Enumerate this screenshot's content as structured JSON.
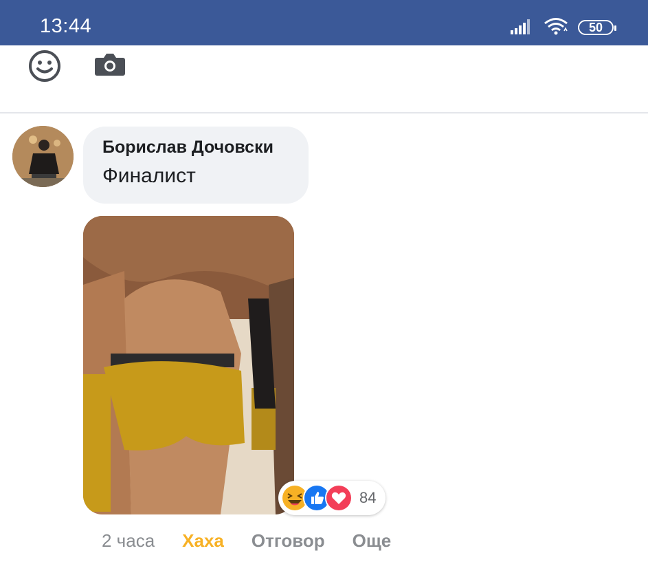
{
  "status_bar": {
    "time": "13:44",
    "battery": "50",
    "icons": [
      "signal-icon",
      "wifi-icon",
      "battery-icon"
    ]
  },
  "composer": {
    "icons": [
      "emoji-icon",
      "camera-icon"
    ]
  },
  "comment": {
    "author": "Борислав Дочовски",
    "text": "Финалист",
    "reactions": {
      "types": [
        "haha-icon",
        "like-icon",
        "love-icon"
      ],
      "count": "84"
    },
    "actions": {
      "time_ago": "2 часа",
      "haha": "Хаха",
      "reply": "Отговор",
      "more": "Още"
    }
  },
  "colors": {
    "status_bar_bg": "#3b5998",
    "bubble_bg": "#f0f2f5",
    "haha_accent": "#f7b125",
    "like_blue": "#1877f2",
    "love_red": "#f33e58",
    "secondary_text": "#8a8d91"
  }
}
